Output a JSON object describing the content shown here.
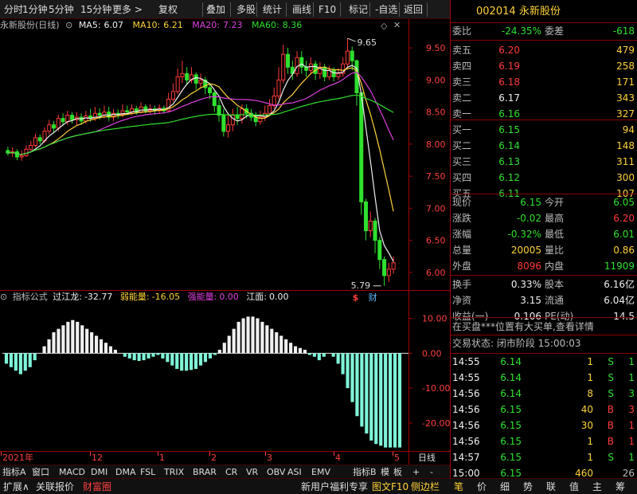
{
  "toolbar": {
    "items": [
      "分时",
      "1分钟",
      "5分钟",
      "15分钟",
      "更多",
      "复权",
      "叠加",
      "多股",
      "统计",
      "画线",
      "F10",
      "标记",
      "-自选",
      "返回"
    ]
  },
  "stock": {
    "code": "002014",
    "name": "永新股份"
  },
  "chart_header": {
    "title": "永新股份(日线)",
    "ma5_label": "MA5:",
    "ma5": "6.07",
    "ma10_label": "MA10:",
    "ma10": "6.21",
    "ma20_label": "MA20:",
    "ma20": "7.23",
    "ma60_label": "MA60:",
    "ma60": "8.36"
  },
  "indicator_header": {
    "name": "指标公式",
    "l1": "过江龙:",
    "v1": "-32.77",
    "l2": "弱能量:",
    "v2": "-16.05",
    "l3": "强能量:",
    "v3": "0.00",
    "l4": "江面:",
    "v4": "0.00"
  },
  "colors": {
    "up": "#ff3b3b",
    "down": "#2fe02f",
    "ma5": "#f0f0f0",
    "ma10": "#ffd23a",
    "ma20": "#e040e0",
    "ma60": "#2fe02f",
    "bear_bar": "#7ff5d8",
    "bull_bar": "#f0f0f0",
    "grid": "#a00000"
  },
  "chart_data": [
    {
      "type": "candlestick",
      "yticks": [
        "9.50",
        "9.00",
        "8.50",
        "8.00",
        "7.50",
        "7.00",
        "6.50",
        "6.00"
      ],
      "ylim": [
        5.75,
        9.75
      ],
      "annotations": {
        "high": "9.65",
        "low": "5.79",
        "markers": [
          "$",
          "财"
        ]
      },
      "candles": [
        [
          7.9,
          7.86,
          7.96,
          7.82
        ],
        [
          7.86,
          7.88,
          7.95,
          7.8
        ],
        [
          7.88,
          7.8,
          7.92,
          7.75
        ],
        [
          7.8,
          7.82,
          7.9,
          7.74
        ],
        [
          7.82,
          7.92,
          7.98,
          7.8
        ],
        [
          7.92,
          7.98,
          8.05,
          7.9
        ],
        [
          7.98,
          8.1,
          8.16,
          7.95
        ],
        [
          8.1,
          8.05,
          8.15,
          8.0
        ],
        [
          8.05,
          8.2,
          8.26,
          8.02
        ],
        [
          8.2,
          8.3,
          8.38,
          8.15
        ],
        [
          8.3,
          8.25,
          8.36,
          8.18
        ],
        [
          8.25,
          8.4,
          8.46,
          8.2
        ],
        [
          8.4,
          8.35,
          8.48,
          8.28
        ],
        [
          8.35,
          8.45,
          8.52,
          8.3
        ],
        [
          8.45,
          8.38,
          8.5,
          8.32
        ],
        [
          8.38,
          8.42,
          8.5,
          8.3
        ],
        [
          8.42,
          8.36,
          8.48,
          8.3
        ],
        [
          8.36,
          8.44,
          8.52,
          8.32
        ],
        [
          8.44,
          8.4,
          8.55,
          8.35
        ],
        [
          8.4,
          8.48,
          8.58,
          8.36
        ],
        [
          8.48,
          8.45,
          8.56,
          8.38
        ],
        [
          8.45,
          8.5,
          8.6,
          8.4
        ],
        [
          8.5,
          8.42,
          8.58,
          8.36
        ],
        [
          8.42,
          8.48,
          8.55,
          8.36
        ],
        [
          8.48,
          8.46,
          8.54,
          8.4
        ],
        [
          8.46,
          8.52,
          8.62,
          8.42
        ],
        [
          8.52,
          8.5,
          8.6,
          8.45
        ],
        [
          8.5,
          8.55,
          8.62,
          8.45
        ],
        [
          8.55,
          8.5,
          8.6,
          8.46
        ],
        [
          8.5,
          8.58,
          8.65,
          8.48
        ],
        [
          8.58,
          8.52,
          8.62,
          8.48
        ],
        [
          8.52,
          8.55,
          8.62,
          8.48
        ],
        [
          8.55,
          8.52,
          8.6,
          8.46
        ],
        [
          8.52,
          8.56,
          8.62,
          8.48
        ],
        [
          8.56,
          8.52,
          8.6,
          8.48
        ],
        [
          8.52,
          8.7,
          8.8,
          8.5
        ],
        [
          8.7,
          8.82,
          8.95,
          8.66
        ],
        [
          8.82,
          9.05,
          9.18,
          8.78
        ],
        [
          9.05,
          9.1,
          9.3,
          8.95
        ],
        [
          9.1,
          9.0,
          9.2,
          8.92
        ],
        [
          9.0,
          9.08,
          9.2,
          8.95
        ],
        [
          9.08,
          8.95,
          9.12,
          8.85
        ],
        [
          8.95,
          9.0,
          9.1,
          8.88
        ],
        [
          9.0,
          8.88,
          9.05,
          8.78
        ],
        [
          8.88,
          8.8,
          8.95,
          8.7
        ],
        [
          8.8,
          8.6,
          8.85,
          8.5
        ],
        [
          8.6,
          8.45,
          8.7,
          8.35
        ],
        [
          8.45,
          8.2,
          8.55,
          8.12
        ],
        [
          8.2,
          8.3,
          8.45,
          8.1
        ],
        [
          8.3,
          8.45,
          8.55,
          8.2
        ],
        [
          8.45,
          8.4,
          8.58,
          8.3
        ],
        [
          8.4,
          8.55,
          8.62,
          8.32
        ],
        [
          8.55,
          8.48,
          8.62,
          8.4
        ],
        [
          8.48,
          8.42,
          8.55,
          8.36
        ],
        [
          8.42,
          8.35,
          8.5,
          8.28
        ],
        [
          8.35,
          8.42,
          8.52,
          8.3
        ],
        [
          8.42,
          8.48,
          8.6,
          8.36
        ],
        [
          8.48,
          8.6,
          8.7,
          8.44
        ],
        [
          8.6,
          8.75,
          8.88,
          8.55
        ],
        [
          8.75,
          9.0,
          9.2,
          8.7
        ],
        [
          9.0,
          9.4,
          9.55,
          8.95
        ],
        [
          9.4,
          9.2,
          9.5,
          9.1
        ],
        [
          9.2,
          9.1,
          9.3,
          9.0
        ],
        [
          9.1,
          9.35,
          9.45,
          9.05
        ],
        [
          9.35,
          9.2,
          9.45,
          9.1
        ],
        [
          9.2,
          9.15,
          9.3,
          9.05
        ],
        [
          9.15,
          9.25,
          9.35,
          9.1
        ],
        [
          9.25,
          9.1,
          9.3,
          9.0
        ],
        [
          9.1,
          9.2,
          9.28,
          9.02
        ],
        [
          9.2,
          9.05,
          9.25,
          8.98
        ],
        [
          9.05,
          9.15,
          9.22,
          9.0
        ],
        [
          9.15,
          9.05,
          9.2,
          8.98
        ],
        [
          9.05,
          9.1,
          9.18,
          9.0
        ],
        [
          9.1,
          9.25,
          9.35,
          9.05
        ],
        [
          9.25,
          9.45,
          9.65,
          9.2
        ],
        [
          9.45,
          9.3,
          9.52,
          9.15
        ],
        [
          9.3,
          8.8,
          9.32,
          8.6
        ],
        [
          8.8,
          7.1,
          8.8,
          6.9
        ],
        [
          7.1,
          6.65,
          7.15,
          6.5
        ],
        [
          6.65,
          6.8,
          6.95,
          6.55
        ],
        [
          6.8,
          6.5,
          6.85,
          6.3
        ],
        [
          6.5,
          6.2,
          6.55,
          6.05
        ],
        [
          6.2,
          5.95,
          6.25,
          5.79
        ],
        [
          5.95,
          6.05,
          6.15,
          5.85
        ],
        [
          6.05,
          6.15,
          6.25,
          5.98
        ]
      ]
    },
    {
      "type": "bar",
      "yticks": [
        "10.00",
        "0.00",
        "-10.00",
        "-20.00"
      ],
      "ylim": [
        -28,
        14
      ],
      "values": [
        -3,
        -4,
        -5,
        -6,
        -5,
        -4,
        -2,
        0,
        2,
        4,
        6,
        7,
        8,
        9,
        9.5,
        9,
        8,
        7,
        6,
        5,
        4,
        3,
        2,
        1,
        0,
        -1,
        -1.5,
        -2,
        -2.2,
        -2,
        -1.5,
        -1,
        -0.5,
        -1.5,
        -2.5,
        -3.5,
        -4.5,
        -5,
        -5,
        -4.8,
        -4.5,
        -3.5,
        -2.5,
        -1.5,
        -0.5,
        1,
        3,
        5,
        7,
        9,
        10,
        10.5,
        10.5,
        10,
        9,
        8,
        7,
        6,
        5,
        4,
        3,
        2,
        1.5,
        1,
        -0.5,
        -1,
        -2,
        -1,
        0,
        -1,
        -3,
        -6,
        -10,
        -14,
        -18,
        -21,
        -23,
        -25,
        -26,
        -26.5,
        -27,
        -27,
        -27,
        -27
      ],
      "bull_threshold": 0
    }
  ],
  "xaxis": {
    "labels": [
      "2021年",
      "12",
      "1",
      "2",
      "3",
      "4",
      "5"
    ],
    "right_label": "日线"
  },
  "tabs": [
    "指标A",
    "窗口",
    "MACD",
    "DMI",
    "DMA",
    "FSL",
    "TRIX",
    "BRAR",
    "CR",
    "VR",
    "OBV",
    "ASI",
    "EMV",
    "指标B",
    "模",
    "板",
    "+",
    "-"
  ],
  "bottom": {
    "left": [
      "扩展∧",
      "关联报价",
      "财富圈"
    ],
    "mid": "新用户福利专享",
    "mid2": "图文F10",
    "mid3": "侧边栏",
    "right": [
      "笔",
      "价",
      "细",
      "势",
      "联",
      "值",
      "主",
      "筹"
    ]
  },
  "quote": {
    "webi_label": "委比",
    "webi": "-24.35%",
    "weicha_label": "委差",
    "weicha": "-618",
    "asks": [
      {
        "label": "卖五",
        "price": "6.20",
        "vol": "479"
      },
      {
        "label": "卖四",
        "price": "6.19",
        "vol": "258"
      },
      {
        "label": "卖三",
        "price": "6.18",
        "vol": "171"
      },
      {
        "label": "卖二",
        "price": "6.17",
        "vol": "343"
      },
      {
        "label": "卖一",
        "price": "6.16",
        "vol": "327"
      }
    ],
    "bids": [
      {
        "label": "买一",
        "price": "6.15",
        "vol": "94"
      },
      {
        "label": "买二",
        "price": "6.14",
        "vol": "148"
      },
      {
        "label": "买三",
        "price": "6.13",
        "vol": "311"
      },
      {
        "label": "买四",
        "price": "6.12",
        "vol": "300"
      },
      {
        "label": "买五",
        "price": "6.11",
        "vol": "107"
      }
    ],
    "stats": [
      {
        "l1": "现价",
        "v1": "6.15",
        "l2": "今开",
        "v2": "6.05"
      },
      {
        "l1": "涨跌",
        "v1": "-0.02",
        "l2": "最高",
        "v2": "6.20"
      },
      {
        "l1": "涨幅",
        "v1": "-0.32%",
        "l2": "最低",
        "v2": "6.01"
      },
      {
        "l1": "总量",
        "v1": "20005",
        "l2": "量比",
        "v2": "0.86"
      },
      {
        "l1": "外盘",
        "v1": "8096",
        "l2": "内盘",
        "v2": "11909"
      }
    ],
    "stats2": [
      {
        "l1": "换手",
        "v1": "0.33%",
        "l2": "股本",
        "v2": "6.16亿"
      },
      {
        "l1": "净资",
        "v1": "3.15",
        "l2": "流通",
        "v2": "6.04亿"
      },
      {
        "l1": "收益(一)",
        "v1": "0.106",
        "l2": "PE(动)",
        "v2": "14.5"
      }
    ],
    "notice": "在买盘***位置有大买单,查看详情",
    "status": "交易状态: 闭市阶段 15:00:03",
    "trades": [
      {
        "t": "14:55",
        "p": "6.14",
        "v": "1",
        "s": "S",
        "n": "1"
      },
      {
        "t": "14:55",
        "p": "6.14",
        "v": "1",
        "s": "S",
        "n": "1"
      },
      {
        "t": "14:56",
        "p": "6.14",
        "v": "8",
        "s": "S",
        "n": "3"
      },
      {
        "t": "14:56",
        "p": "6.15",
        "v": "40",
        "s": "B",
        "n": "3"
      },
      {
        "t": "14:56",
        "p": "6.15",
        "v": "30",
        "s": "B",
        "n": "1"
      },
      {
        "t": "14:56",
        "p": "6.15",
        "v": "1",
        "s": "B",
        "n": "1"
      },
      {
        "t": "14:57",
        "p": "6.15",
        "v": "1",
        "s": "S",
        "n": "1"
      },
      {
        "t": "15:00",
        "p": "6.15",
        "v": "460",
        "s": "",
        "n": "26"
      }
    ]
  }
}
